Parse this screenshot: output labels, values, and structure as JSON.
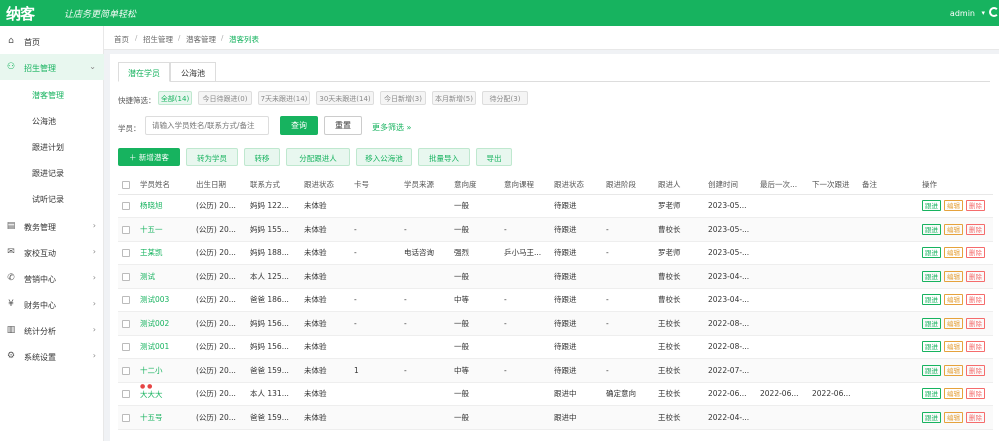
{
  "header": {
    "logo": "纳客",
    "slogan": "让店务更简单轻松",
    "user": "admin",
    "caret": "▾"
  },
  "sidebar": {
    "items": [
      {
        "label": "首页",
        "icon": "home-icon",
        "glyph": "⌂"
      },
      {
        "label": "招生管理",
        "icon": "user-plus-icon",
        "glyph": "⚇"
      },
      {
        "label": "教务管理",
        "icon": "book-icon",
        "glyph": "▤"
      },
      {
        "label": "家校互动",
        "icon": "chat-icon",
        "glyph": "✉"
      },
      {
        "label": "营销中心",
        "icon": "megaphone-icon",
        "glyph": "✆"
      },
      {
        "label": "财务中心",
        "icon": "wallet-icon",
        "glyph": "¥"
      },
      {
        "label": "统计分析",
        "icon": "chart-icon",
        "glyph": "▥"
      },
      {
        "label": "系统设置",
        "icon": "gear-icon",
        "glyph": "⚙"
      }
    ],
    "subitems": [
      "潜客管理",
      "公海池",
      "跟进计划",
      "跟进记录",
      "试听记录"
    ],
    "arrow_down": "⌄",
    "arrow_right": "›"
  },
  "breadcrumb": [
    "首页",
    "招生管理",
    "潜客管理",
    "潜客列表"
  ],
  "tabs": [
    "潜在学员",
    "公海池"
  ],
  "quick_filter": {
    "label": "快捷筛选：",
    "chips": [
      "全部(14)",
      "今日待跟进(0)",
      "7天未跟进(14)",
      "30天未跟进(14)",
      "今日新增(3)",
      "本月新增(5)",
      "待分配(3)"
    ]
  },
  "search": {
    "label": "学员：",
    "placeholder": "请输入学员姓名/联系方式/备注",
    "query_button": "查询",
    "reset_button": "重置",
    "more_filter": "更多筛选 »"
  },
  "actions": [
    "＋ 新增潜客",
    "转为学员",
    "转移",
    "分配跟进人",
    "移入公海池",
    "批量导入",
    "导出"
  ],
  "table": {
    "columns": [
      "学员姓名",
      "出生日期",
      "联系方式",
      "跟进状态",
      "卡号",
      "学员来源",
      "意向度",
      "意向课程",
      "跟进状态",
      "跟进阶段",
      "跟进人",
      "创建时间",
      "最后一次...",
      "下一次跟进",
      "备注",
      "操作"
    ],
    "ops": [
      "跟进",
      "编辑",
      "删除"
    ],
    "rows": [
      [
        "杨晓旭",
        "(公历) 20...",
        "妈妈 122...",
        "未体验",
        "",
        "",
        "一般",
        "",
        "待跟进",
        "",
        "罗老师",
        "2023-05...",
        "",
        "",
        ""
      ],
      [
        "十五一",
        "(公历) 20...",
        "妈妈 155...",
        "未体验",
        "-",
        "-",
        "一般",
        "-",
        "待跟进",
        "-",
        "曹校长",
        "2023-05-...",
        "",
        "",
        ""
      ],
      [
        "王某凯",
        "(公历) 20...",
        "妈妈 188...",
        "未体验",
        "-",
        "电话咨询",
        "强烈",
        "乒小马王...",
        "待跟进",
        "-",
        "罗老师",
        "2023-05-...",
        "",
        "",
        ""
      ],
      [
        "测试",
        "(公历) 20...",
        "本人 125...",
        "未体验",
        "",
        "",
        "一般",
        "",
        "待跟进",
        "",
        "曹校长",
        "2023-04-...",
        "",
        "",
        ""
      ],
      [
        "测试003",
        "(公历) 20...",
        "爸爸 186...",
        "未体验",
        "-",
        "-",
        "中等",
        "-",
        "待跟进",
        "-",
        "曹校长",
        "2023-04-...",
        "",
        "",
        ""
      ],
      [
        "测试002",
        "(公历) 20...",
        "妈妈 156...",
        "未体验",
        "-",
        "-",
        "一般",
        "-",
        "待跟进",
        "-",
        "王校长",
        "2022-08-...",
        "",
        "",
        ""
      ],
      [
        "测试001",
        "(公历) 20...",
        "妈妈 156...",
        "未体验",
        "",
        "",
        "一般",
        "",
        "待跟进",
        "",
        "王校长",
        "2022-08-...",
        "",
        "",
        ""
      ],
      [
        "十二小",
        "(公历) 20...",
        "爸爸 159...",
        "未体验",
        "1",
        "-",
        "中等",
        "-",
        "待跟进",
        "-",
        "王校长",
        "2022-07-...",
        "",
        "",
        ""
      ],
      [
        "大大大",
        "(公历) 20...",
        "本人 131...",
        "未体验",
        "",
        "",
        "一般",
        "",
        "跟进中",
        "确定意向",
        "王校长",
        "2022-06...",
        "2022-06...",
        "2022-06...",
        ""
      ],
      [
        "十五号",
        "(公历) 20...",
        "爸爸 159...",
        "未体验",
        "",
        "",
        "一般",
        "",
        "跟进中",
        "",
        "王校长",
        "2022-04-...",
        "",
        "",
        ""
      ]
    ],
    "row_stars": "● ●"
  },
  "colors": {
    "accent": "#17b35f",
    "edit": "#e6a23c",
    "delete": "#f56c6c"
  }
}
